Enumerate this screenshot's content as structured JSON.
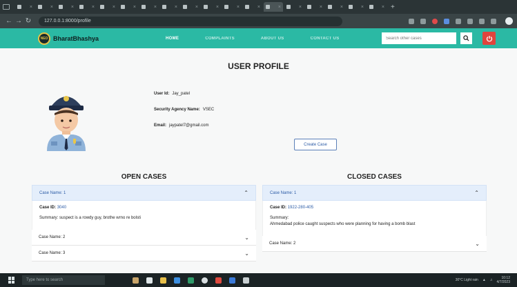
{
  "browser": {
    "tabs": [
      "(edit",
      "Setti",
      "Flos",
      "Proc",
      "Searc",
      "",
      "",
      "",
      "Mon",
      "ECB",
      "",
      "pelis",
      "whit",
      "Gmail",
      "",
      "fave",
      "",
      ""
    ],
    "active_tab": 12,
    "url": "127.0.0.1:8000/profile"
  },
  "navbar": {
    "brand": "BharatBhashya",
    "logo_text": "NEO",
    "links": [
      "HOME",
      "COMPLAINTS",
      "ABOUT US",
      "CONTACT US"
    ],
    "search_placeholder": "Search other cases"
  },
  "profile": {
    "title": "USER PROFILE",
    "user_id_label": "User Id:",
    "user_id": "Jay_patel",
    "agency_label": "Security Agency Name:",
    "agency": "VSEC",
    "email_label": "Email:",
    "email": "jaypatel7@gmail.com",
    "create_case_label": "Create Case"
  },
  "open_cases": {
    "title": "OPEN CASES",
    "items": [
      {
        "label": "Case Name: 1",
        "expanded": true,
        "case_id_label": "Case ID:",
        "case_id": "3040",
        "summary_label": "Summary:",
        "summary": "suspect is a rowdy guy, brothe wrno re bolsti"
      },
      {
        "label": "Case Name: 2",
        "expanded": false
      },
      {
        "label": "Case Name: 3",
        "expanded": false
      }
    ]
  },
  "closed_cases": {
    "title": "CLOSED CASES",
    "items": [
      {
        "label": "Case Name: 1",
        "expanded": true,
        "case_id_label": "Case ID:",
        "case_id": "1922-280-405",
        "summary_label": "Summary:",
        "summary": "Ahmedabad police caught suspects who were planning for having a bomb blast"
      },
      {
        "label": "Case Name: 2",
        "expanded": false
      }
    ]
  },
  "taskbar": {
    "search_placeholder": "Type here to search",
    "weather": "30°C Light rain",
    "time": "10:12",
    "date": "4/7/2023"
  },
  "colors": {
    "navbar": "#2bb9a4",
    "logout": "#e0443d",
    "accent_blue": "#2a5aa5"
  }
}
